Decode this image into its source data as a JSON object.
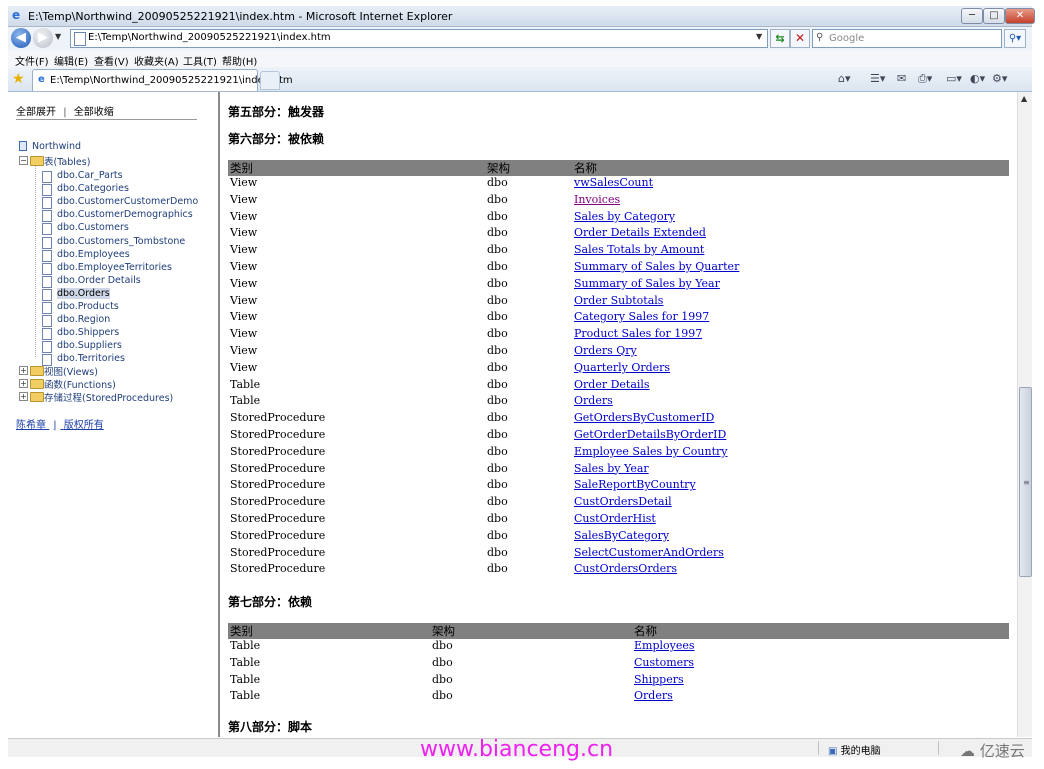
{
  "window": {
    "title": "E:\\Temp\\Northwind_20090525221921\\index.htm - Microsoft Internet Explorer",
    "minimize_glyph": "─",
    "maximize_glyph": "□",
    "close_glyph": "✕"
  },
  "addressbar": {
    "url": "E:\\Temp\\Northwind_20090525221921\\index.htm",
    "search_placeholder": "Google"
  },
  "menu": [
    "文件(F)",
    "编辑(E)",
    "查看(V)",
    "收藏夹(A)",
    "工具(T)",
    "帮助(H)"
  ],
  "tab": {
    "label": "E:\\Temp\\Northwind_20090525221921\\index.htm"
  },
  "sidebar": {
    "expand_all": "全部展开",
    "collapse_all": "全部收缩",
    "link_separator": "|",
    "root": "Northwind",
    "tables_folder": "表(Tables)",
    "tables": [
      "dbo.Car_Parts",
      "dbo.Categories",
      "dbo.CustomerCustomerDemo",
      "dbo.CustomerDemographics",
      "dbo.Customers",
      "dbo.Customers_Tombstone",
      "dbo.Employees",
      "dbo.EmployeeTerritories",
      "dbo.Order Details",
      "dbo.Orders",
      "dbo.Products",
      "dbo.Region",
      "dbo.Shippers",
      "dbo.Suppliers",
      "dbo.Territories"
    ],
    "selected_table": "dbo.Orders",
    "views_folder": "视图(Views)",
    "functions_folder": "函数(Functions)",
    "procs_folder": "存储过程(StoredProcedures)",
    "footer_author": "陈希章",
    "footer_separator": "|",
    "footer_rights": "版权所有"
  },
  "content": {
    "section5": "第五部分：触发器",
    "section6": "第六部分：被依赖",
    "section7": "第七部分：依赖",
    "section8": "第八部分：脚本",
    "headers": {
      "type": "类别",
      "schema": "架构",
      "name": "名称"
    },
    "dependents": [
      {
        "type": "View",
        "schema": "dbo",
        "name": "vwSalesCount"
      },
      {
        "type": "View",
        "schema": "dbo",
        "name": "Invoices"
      },
      {
        "type": "View",
        "schema": "dbo",
        "name": "Sales by Category"
      },
      {
        "type": "View",
        "schema": "dbo",
        "name": "Order Details Extended"
      },
      {
        "type": "View",
        "schema": "dbo",
        "name": "Sales Totals by Amount"
      },
      {
        "type": "View",
        "schema": "dbo",
        "name": "Summary of Sales by Quarter"
      },
      {
        "type": "View",
        "schema": "dbo",
        "name": "Summary of Sales by Year"
      },
      {
        "type": "View",
        "schema": "dbo",
        "name": "Order Subtotals"
      },
      {
        "type": "View",
        "schema": "dbo",
        "name": "Category Sales for 1997"
      },
      {
        "type": "View",
        "schema": "dbo",
        "name": "Product Sales for 1997"
      },
      {
        "type": "View",
        "schema": "dbo",
        "name": "Orders Qry"
      },
      {
        "type": "View",
        "schema": "dbo",
        "name": "Quarterly Orders"
      },
      {
        "type": "Table",
        "schema": "dbo",
        "name": "Order Details"
      },
      {
        "type": "Table",
        "schema": "dbo",
        "name": "Orders"
      },
      {
        "type": "StoredProcedure",
        "schema": "dbo",
        "name": "GetOrdersByCustomerID"
      },
      {
        "type": "StoredProcedure",
        "schema": "dbo",
        "name": "GetOrderDetailsByOrderID"
      },
      {
        "type": "StoredProcedure",
        "schema": "dbo",
        "name": "Employee Sales by Country"
      },
      {
        "type": "StoredProcedure",
        "schema": "dbo",
        "name": "Sales by Year"
      },
      {
        "type": "StoredProcedure",
        "schema": "dbo",
        "name": "SaleReportByCountry"
      },
      {
        "type": "StoredProcedure",
        "schema": "dbo",
        "name": "CustOrdersDetail"
      },
      {
        "type": "StoredProcedure",
        "schema": "dbo",
        "name": "CustOrderHist"
      },
      {
        "type": "StoredProcedure",
        "schema": "dbo",
        "name": "SalesByCategory"
      },
      {
        "type": "StoredProcedure",
        "schema": "dbo",
        "name": "SelectCustomerAndOrders"
      },
      {
        "type": "StoredProcedure",
        "schema": "dbo",
        "name": "CustOrdersOrders"
      }
    ],
    "visited_link": "Invoices",
    "dependencies": [
      {
        "type": "Table",
        "schema": "dbo",
        "name": "Employees"
      },
      {
        "type": "Table",
        "schema": "dbo",
        "name": "Customers"
      },
      {
        "type": "Table",
        "schema": "dbo",
        "name": "Shippers"
      },
      {
        "type": "Table",
        "schema": "dbo",
        "name": "Orders"
      }
    ]
  },
  "statusbar": {
    "zone": "我的电脑"
  },
  "watermark": "www.bianceng.cn",
  "brand": "亿速云",
  "colors": {
    "link": "#0000cc",
    "visited": "#800080",
    "header_bg": "#808080",
    "watermark": "#ee22ee"
  }
}
